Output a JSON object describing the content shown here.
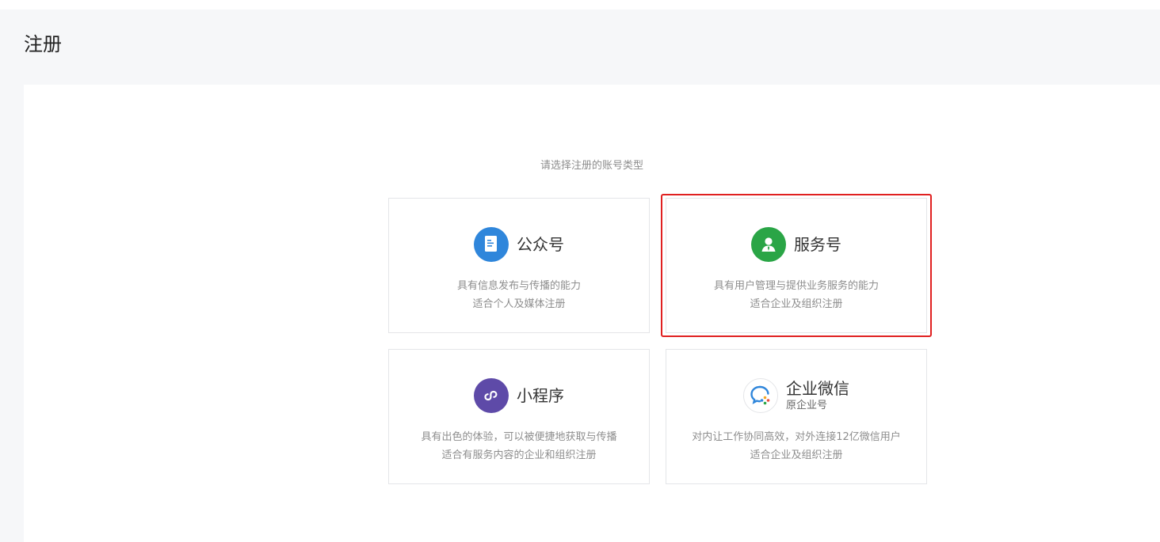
{
  "page": {
    "title": "注册"
  },
  "panel": {
    "subtitle": "请选择注册的账号类型"
  },
  "cards": [
    {
      "title": "公众号",
      "icon": "document-icon",
      "icon_color": "#2f86db",
      "lines": [
        "具有信息发布与传播的能力",
        "适合个人及媒体注册"
      ]
    },
    {
      "title": "服务号",
      "icon": "service-person-icon",
      "icon_color": "#2aa546",
      "lines": [
        "具有用户管理与提供业务服务的能力",
        "适合企业及组织注册"
      ]
    },
    {
      "title": "小程序",
      "icon": "miniprogram-icon",
      "icon_color": "#5e4aa8",
      "lines": [
        "具有出色的体验，可以被便捷地获取与传播",
        "适合有服务内容的企业和组织注册"
      ]
    },
    {
      "title": "企业微信",
      "subtitle": "原企业号",
      "icon": "wecom-icon",
      "lines": [
        "对内让工作协同高效，对外连接12亿微信用户",
        "适合企业及组织注册"
      ]
    }
  ],
  "highlight_color": "#e02020"
}
